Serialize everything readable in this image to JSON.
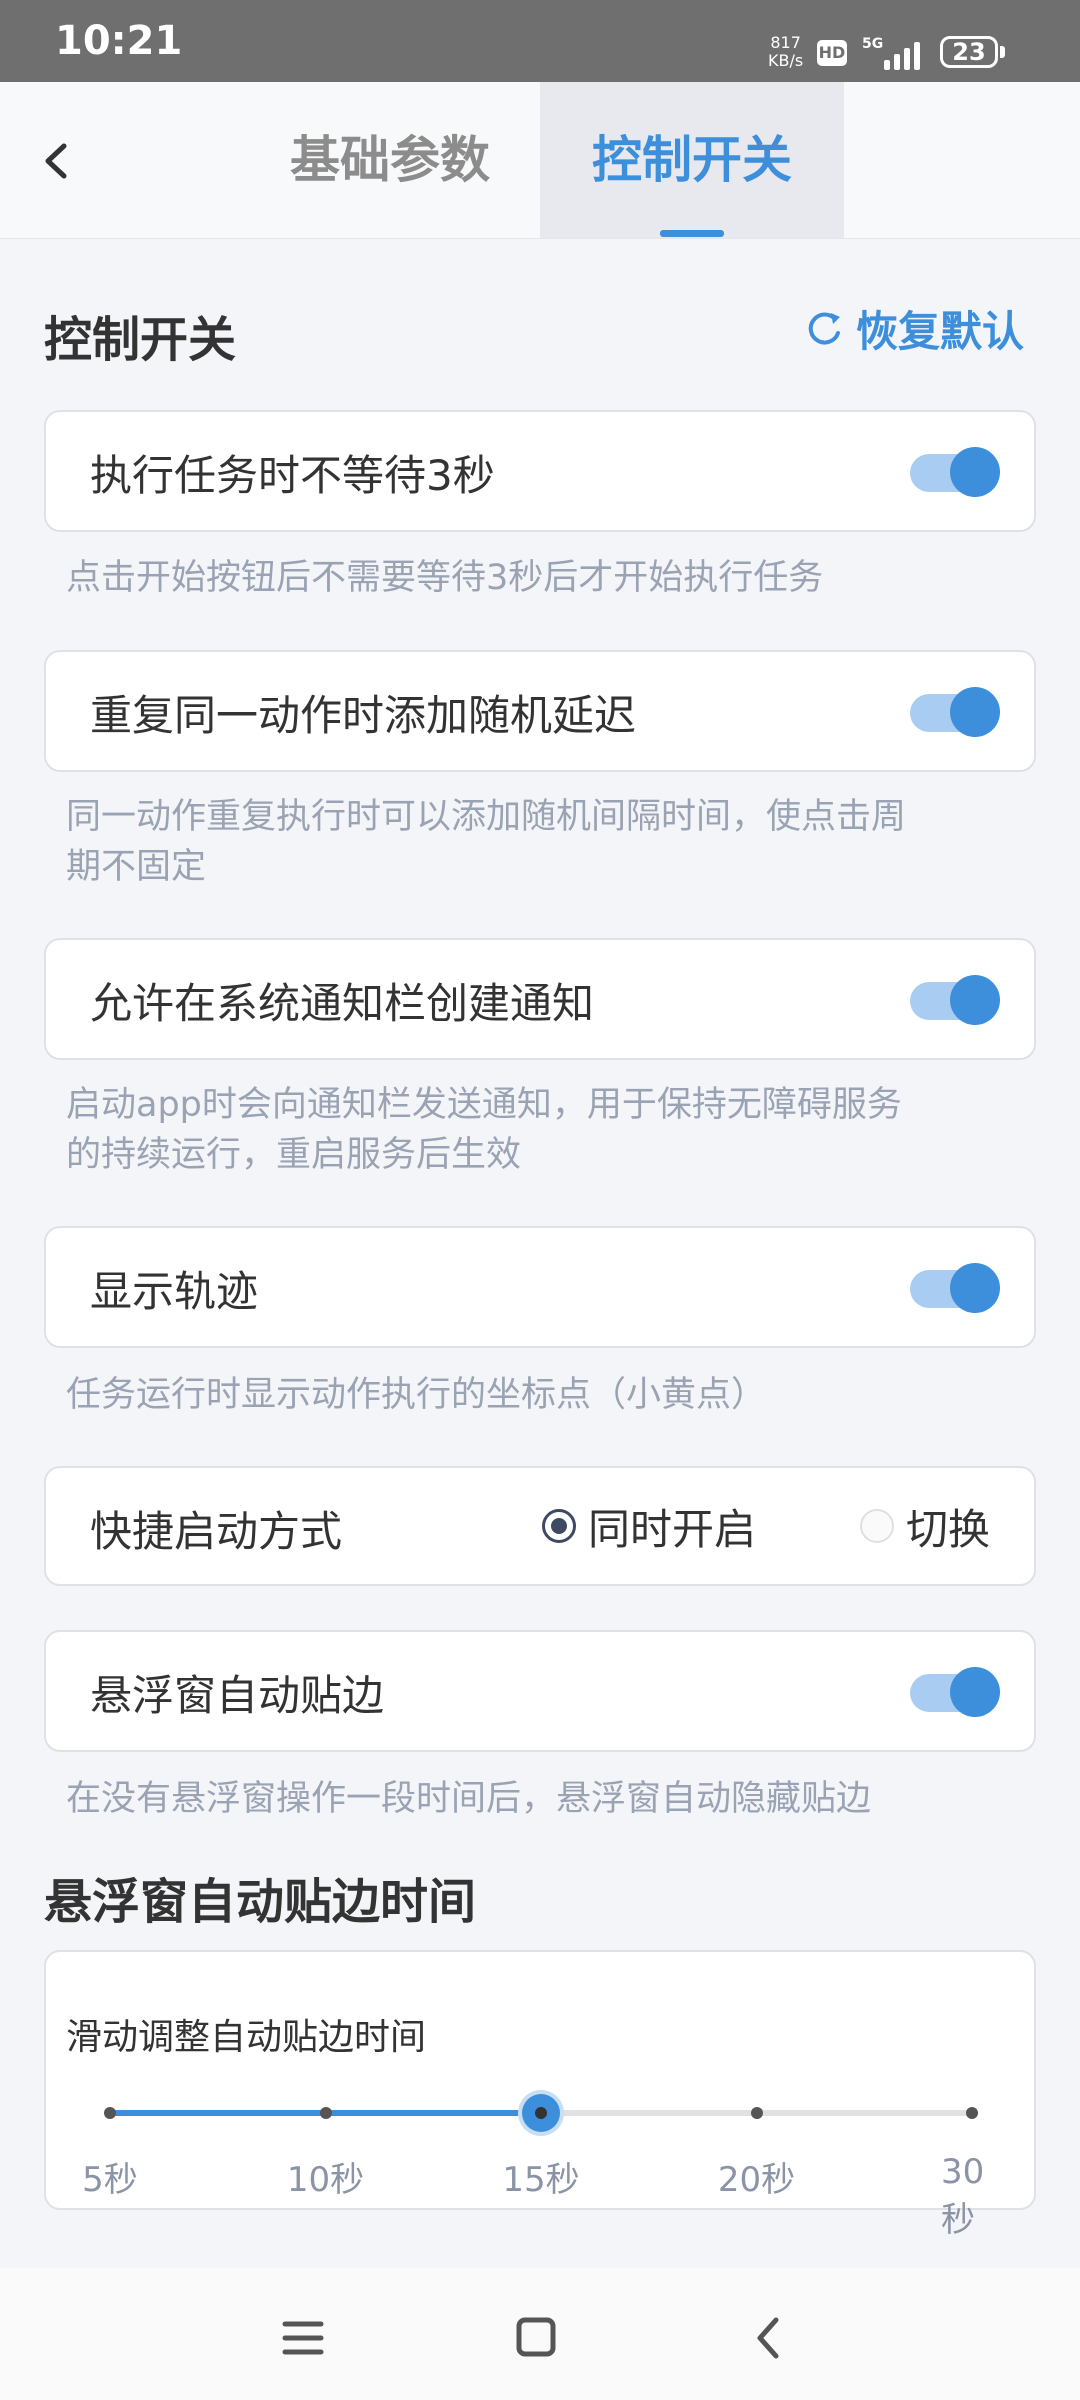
{
  "status_bar": {
    "time": "10:21",
    "net_speed_value": "817",
    "net_speed_unit": "KB/s",
    "hd_badge": "HD",
    "network": "5G",
    "battery": "23"
  },
  "header": {
    "tabs": [
      {
        "label": "基础参数",
        "active": false
      },
      {
        "label": "控制开关",
        "active": true
      }
    ]
  },
  "section": {
    "title": "控制开关",
    "restore_label": "恢复默认"
  },
  "settings": [
    {
      "label": "执行任务时不等待3秒",
      "enabled": true,
      "description": "点击开始按钮后不需要等待3秒后才开始执行任务"
    },
    {
      "label": "重复同一动作时添加随机延迟",
      "enabled": true,
      "description_line1": "同一动作重复执行时可以添加随机间隔时间，使点击周",
      "description_line2": "期不固定"
    },
    {
      "label": "允许在系统通知栏创建通知",
      "enabled": true,
      "description_line1": "启动app时会向通知栏发送通知，用于保持无障碍服务",
      "description_line2": "的持续运行，重启服务后生效"
    },
    {
      "label": "显示轨迹",
      "enabled": true,
      "description": "任务运行时显示动作执行的坐标点（小黄点）"
    }
  ],
  "launch_mode": {
    "label": "快捷启动方式",
    "options": [
      "同时开启",
      "切换"
    ],
    "selected": "同时开启"
  },
  "float_snap": {
    "label": "悬浮窗自动贴边",
    "enabled": true,
    "description": "在没有悬浮窗操作一段时间后，悬浮窗自动隐藏贴边"
  },
  "snap_time": {
    "title": "悬浮窗自动贴边时间",
    "hint": "滑动调整自动贴边时间",
    "ticks": [
      "5秒",
      "10秒",
      "15秒",
      "20秒",
      "30秒"
    ],
    "selected_index": 2
  },
  "colors": {
    "accent": "#3d8fdb",
    "toggle_track": "#a9cdf2",
    "desc_text": "#9aa3b3"
  }
}
